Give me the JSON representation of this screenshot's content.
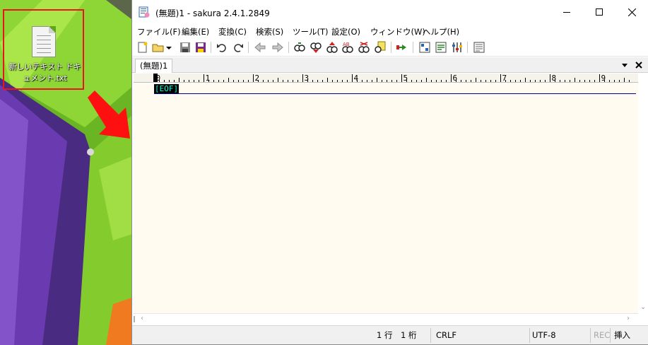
{
  "desktop": {
    "icon_label": "新しいテキスト ドキュメント.txt"
  },
  "window": {
    "title": "(無題)1 - sakura 2.4.1.2849",
    "controls": {
      "minimize_icon": "minimize-icon",
      "maximize_icon": "maximize-icon",
      "close_icon": "close-icon"
    }
  },
  "menu": [
    {
      "label": "ファイル(F)"
    },
    {
      "label": "編集(E)"
    },
    {
      "label": "変換(C)"
    },
    {
      "label": "検索(S)"
    },
    {
      "label": "ツール(T)"
    },
    {
      "label": "設定(O)"
    },
    {
      "label": "ウィンドウ(W)"
    },
    {
      "label": "ヘルプ(H)"
    }
  ],
  "toolbar": [
    "new-file-icon",
    "open-file-icon",
    "open-dropdown-icon",
    "save-icon",
    "save-all-icon",
    "undo-icon",
    "redo-icon",
    "jump-back-icon",
    "jump-forward-icon",
    "search-icon",
    "find-prev-icon",
    "find-next-icon",
    "replace-icon",
    "grep-icon",
    "bookmark-icon",
    "tag-jump-icon",
    "compare-icon",
    "outline-icon",
    "settings-icon",
    "font-settings-icon"
  ],
  "tabs": [
    {
      "label": "(無題)1"
    }
  ],
  "ruler": {
    "labels": [
      "0",
      "1",
      "2",
      "3",
      "4",
      "5",
      "6",
      "7",
      "8",
      "9"
    ]
  },
  "editor": {
    "eof_marker": "[EOF]"
  },
  "status": {
    "line": "1 行",
    "column": "1 桁",
    "line_ending": "CRLF",
    "encoding": "UTF-8",
    "rec": "REC",
    "mode": "挿入"
  },
  "colors": {
    "editor_bg": "#fffbf0",
    "eof_bg": "#000000",
    "eof_fg": "#00ffe0",
    "underline": "#0000a0",
    "highlight_border": "#e8161c"
  }
}
